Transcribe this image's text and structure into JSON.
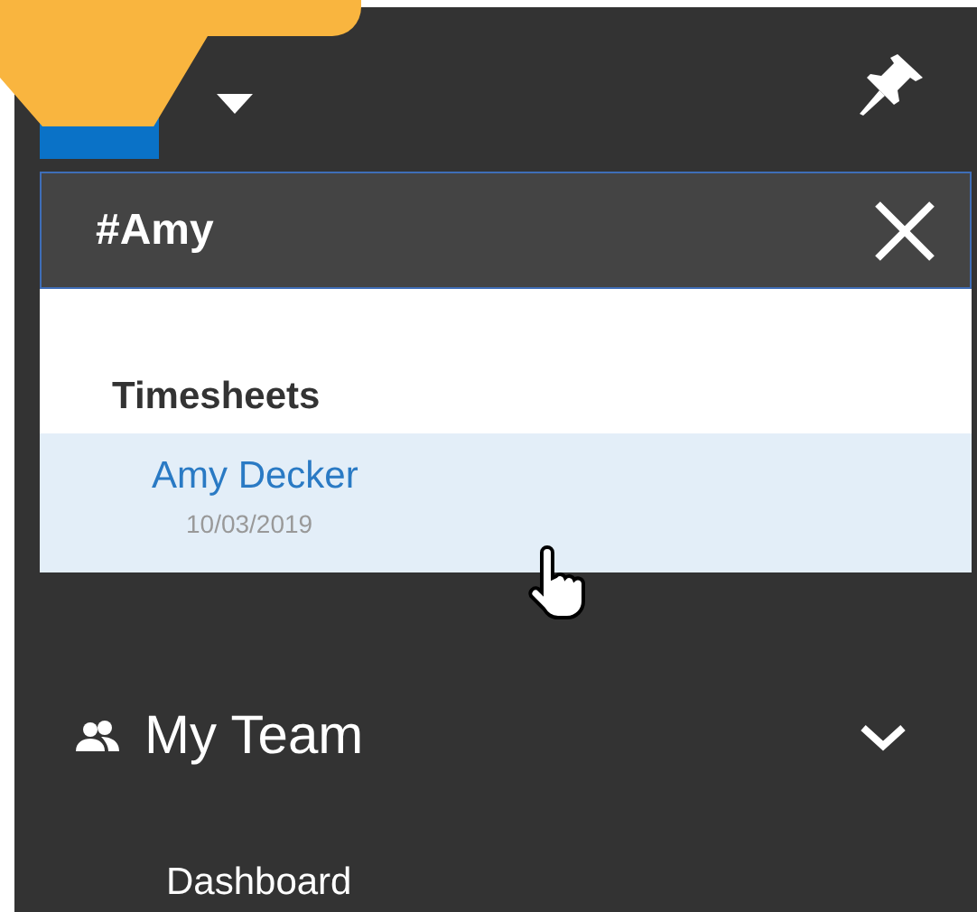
{
  "search": {
    "value": "#Amy"
  },
  "results": {
    "group": "Timesheets",
    "items": [
      {
        "name": "Amy Decker",
        "date": "10/03/2019",
        "selected": true
      }
    ]
  },
  "nav": [
    {
      "label": "My Team",
      "expanded": true,
      "children": [
        "Dashboard"
      ]
    }
  ]
}
